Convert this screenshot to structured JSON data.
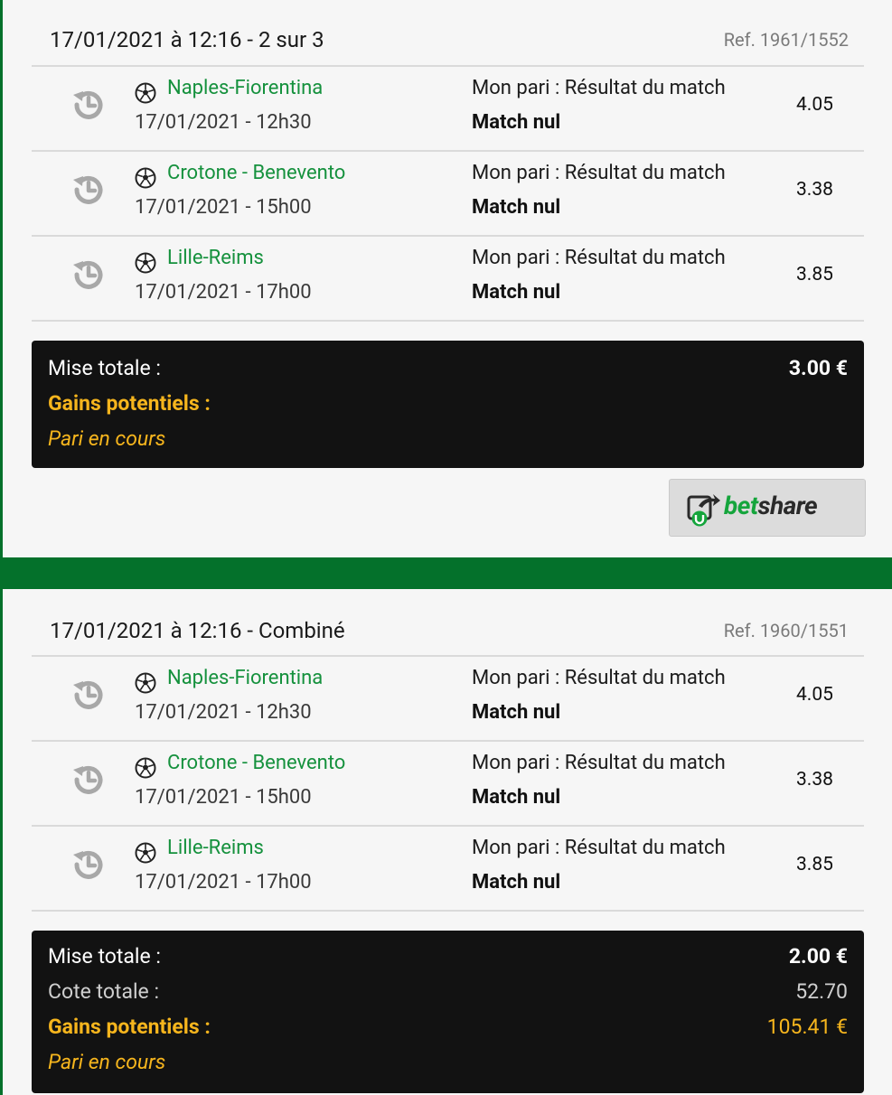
{
  "bets": [
    {
      "title": "17/01/2021 à 12:16 - 2 sur 3",
      "ref": "Ref. 1961/1552",
      "selections": [
        {
          "match": "Naples-Fiorentina",
          "datetime": "17/01/2021 - 12h30",
          "bet_label": "Mon pari : Résultat du match",
          "choice": "Match nul",
          "odds": "4.05"
        },
        {
          "match": "Crotone - Benevento",
          "datetime": "17/01/2021 - 15h00",
          "bet_label": "Mon pari : Résultat du match",
          "choice": "Match nul",
          "odds": "3.38"
        },
        {
          "match": "Lille-Reims",
          "datetime": "17/01/2021 - 17h00",
          "bet_label": "Mon pari : Résultat du match",
          "choice": "Match nul",
          "odds": "3.85"
        }
      ],
      "summary": {
        "stake_label": "Mise totale :",
        "stake_value": "3.00 €",
        "gains_label": "Gains potentiels :",
        "status": "Pari en cours"
      },
      "betshare": {
        "bet": "bet",
        "share": "share"
      }
    },
    {
      "title": "17/01/2021 à 12:16 - Combiné",
      "ref": "Ref. 1960/1551",
      "selections": [
        {
          "match": "Naples-Fiorentina",
          "datetime": "17/01/2021 - 12h30",
          "bet_label": "Mon pari : Résultat du match",
          "choice": "Match nul",
          "odds": "4.05"
        },
        {
          "match": "Crotone - Benevento",
          "datetime": "17/01/2021 - 15h00",
          "bet_label": "Mon pari : Résultat du match",
          "choice": "Match nul",
          "odds": "3.38"
        },
        {
          "match": "Lille-Reims",
          "datetime": "17/01/2021 - 17h00",
          "bet_label": "Mon pari : Résultat du match",
          "choice": "Match nul",
          "odds": "3.85"
        }
      ],
      "summary": {
        "stake_label": "Mise totale :",
        "stake_value": "2.00 €",
        "odds_label": "Cote totale :",
        "odds_value": "52.70",
        "gains_label": "Gains potentiels :",
        "gains_value": "105.41 €",
        "status": "Pari en cours"
      }
    }
  ],
  "icons": {
    "history": "history-icon",
    "sport": "soccer-ball-icon",
    "betshare": "betshare-logo-icon"
  },
  "colors": {
    "brand_green": "#04712b",
    "match_green": "#15913d",
    "gains_yellow": "#f6b51d",
    "summary_bg": "#121212"
  }
}
